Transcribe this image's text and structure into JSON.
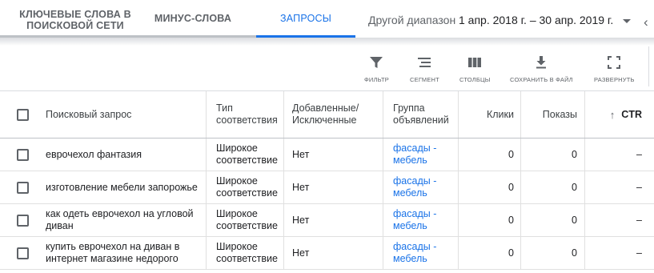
{
  "tabs": [
    {
      "label": "КЛЮЧЕВЫЕ СЛОВА В ПОИСКОВОЙ СЕТИ"
    },
    {
      "label": "МИНУС-СЛОВА"
    },
    {
      "label": "ЗАПРОСЫ"
    }
  ],
  "date_range": {
    "label": "Другой диапазон",
    "value": "1 апр. 2018 г. – 30 апр. 2019 г."
  },
  "toolbar": {
    "filter": "ФИЛЬТР",
    "segment": "СЕГМЕНТ",
    "columns": "СТОЛБЦЫ",
    "download": "СОХРАНИТЬ В ФАЙЛ",
    "expand": "РАЗВЕРНУТЬ"
  },
  "table": {
    "headers": {
      "query": "Поисковый запрос",
      "match_type": "Тип соответствия",
      "added": "Добавленные/ Исключенные",
      "ad_group": "Группа объявлений",
      "clicks": "Клики",
      "impressions": "Показы",
      "ctr": "CTR"
    },
    "rows": [
      {
        "query": "еврочехол фантазия",
        "match_type": "Широкое соответствие",
        "added": "Нет",
        "ad_group": "фасады - мебель",
        "clicks": "0",
        "impressions": "0",
        "ctr": "–"
      },
      {
        "query": "изготовление мебели запорожье",
        "match_type": "Широкое соответствие",
        "added": "Нет",
        "ad_group": "фасады - мебель",
        "clicks": "0",
        "impressions": "0",
        "ctr": "–"
      },
      {
        "query": "как одеть еврочехол на угловой диван",
        "match_type": "Широкое соответствие",
        "added": "Нет",
        "ad_group": "фасады - мебель",
        "clicks": "0",
        "impressions": "0",
        "ctr": "–"
      },
      {
        "query": "купить еврочехол на диван в интернет магазине недорого",
        "match_type": "Широкое соответствие",
        "added": "Нет",
        "ad_group": "фасады - мебель",
        "clicks": "0",
        "impressions": "0",
        "ctr": "–"
      }
    ]
  },
  "colors": {
    "accent": "#1a73e8",
    "text": "#202124",
    "muted": "#5f6368"
  }
}
